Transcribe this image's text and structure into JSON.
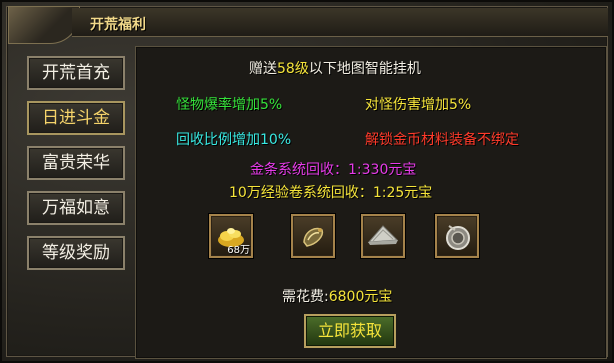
{
  "window": {
    "title": "开荒福利"
  },
  "sidebar": {
    "items": [
      {
        "label": "开荒首充",
        "active": false
      },
      {
        "label": "日进斗金",
        "active": true
      },
      {
        "label": "富贵荣华",
        "active": false
      },
      {
        "label": "万福如意",
        "active": false
      },
      {
        "label": "等级奖励",
        "active": false
      }
    ]
  },
  "main": {
    "line1": {
      "pre": "赠送",
      "level": "58级",
      "post": "以下地图智能挂机"
    },
    "perk_drop": "怪物爆率增加5%",
    "perk_damage": "对怪伤害增加5%",
    "perk_recycle": "回收比例增加10%",
    "perk_unbind": "解锁金币材料装备不绑定",
    "gold_recycle": "金条系统回收：1:330元宝",
    "exp_recycle": "10万经验卷系统回收：1:25元宝",
    "items": [
      {
        "icon": "gold-pile-icon",
        "label": "68万"
      },
      {
        "icon": "scroll-icon",
        "label": ""
      },
      {
        "icon": "bamboo-hat-icon",
        "label": ""
      },
      {
        "icon": "amulet-icon",
        "label": ""
      }
    ],
    "cost": {
      "label": "需花费:",
      "value": "6800元宝"
    },
    "claim_button": "立即获取"
  },
  "colors": {
    "yellow": "#f5e43a",
    "green": "#35e23a",
    "cyan": "#38e9e2",
    "red": "#ff3a2a",
    "magenta": "#e63be8",
    "white": "#f3efe4"
  }
}
